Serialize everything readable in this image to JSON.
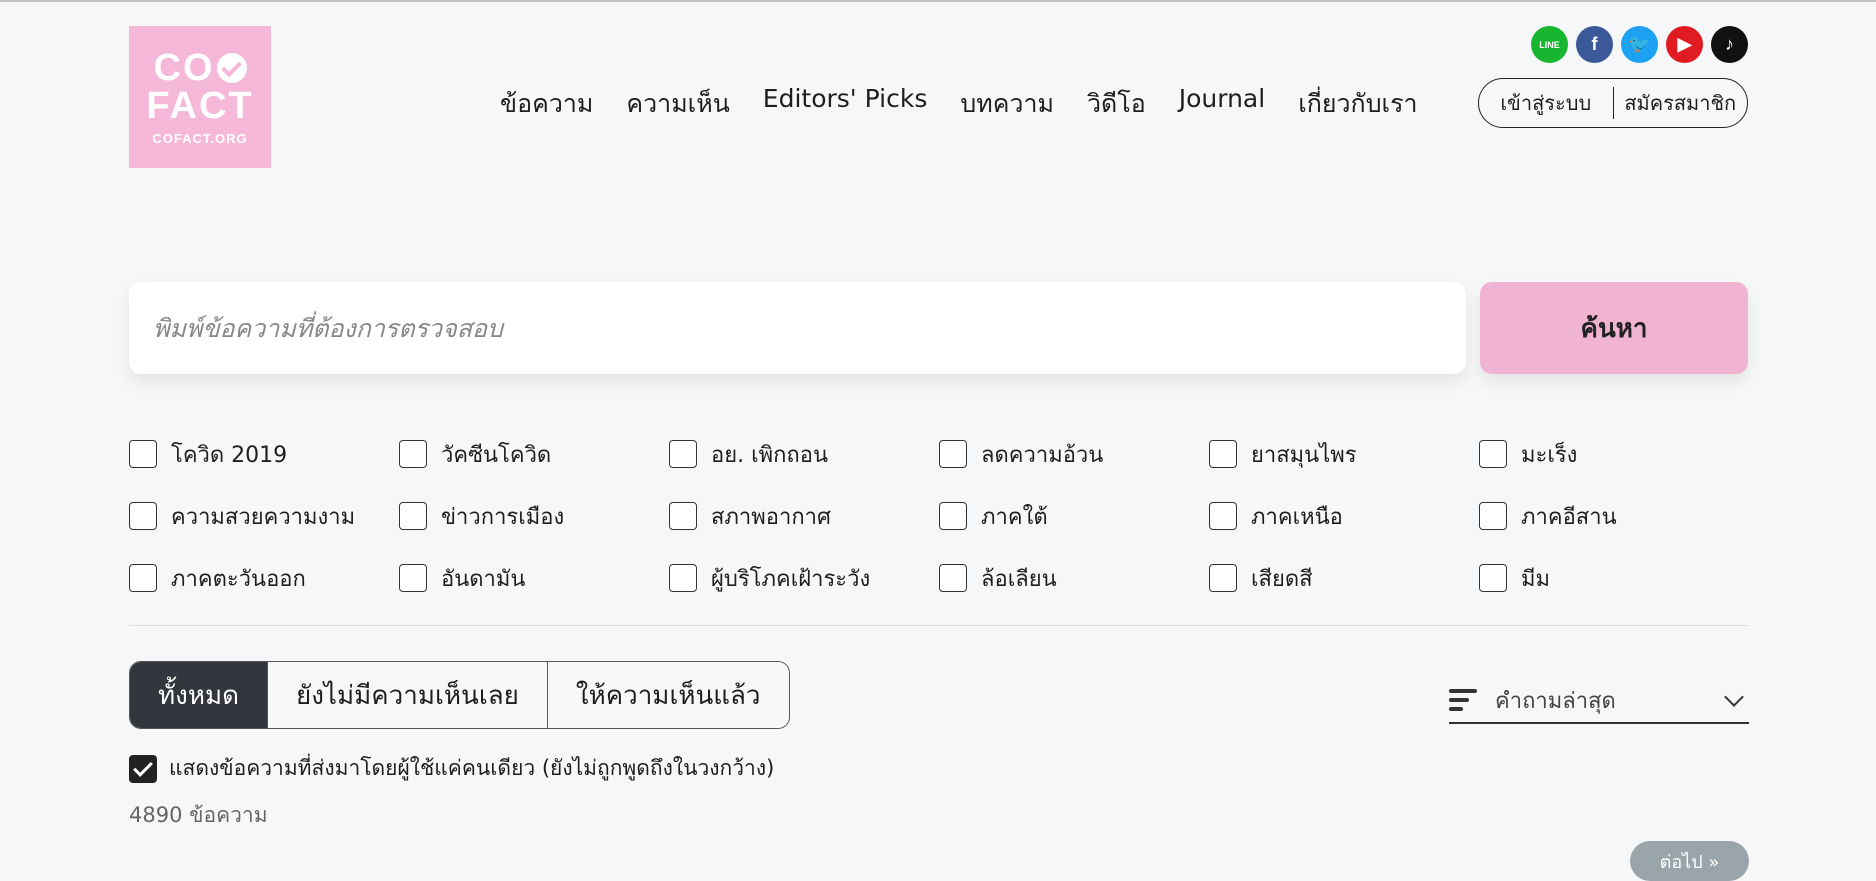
{
  "logo": {
    "line1": "CO",
    "line2": "FACT",
    "line3": "COFACT.ORG"
  },
  "social": [
    {
      "name": "line-icon",
      "glyph": "LINE"
    },
    {
      "name": "facebook-icon",
      "glyph": "f"
    },
    {
      "name": "twitter-icon",
      "glyph": "🐦"
    },
    {
      "name": "youtube-icon",
      "glyph": "▶"
    },
    {
      "name": "tiktok-icon",
      "glyph": "♪"
    }
  ],
  "nav": {
    "items": [
      "ข้อความ",
      "ความเห็น",
      "Editors' Picks",
      "บทความ",
      "วิดีโอ",
      "Journal",
      "เกี่ยวกับเรา"
    ]
  },
  "auth": {
    "login": "เข้าสู่ระบบ",
    "register": "สมัครสมาชิก"
  },
  "search": {
    "placeholder": "พิมพ์ข้อความที่ต้องการตรวจสอบ",
    "button": "ค้นหา"
  },
  "tags": [
    "โควิด 2019",
    "วัคซีนโควิด",
    "อย. เพิกถอน",
    "ลดความอ้วน",
    "ยาสมุนไพร",
    "มะเร็ง",
    "ความสวยความงาม",
    "ข่าวการเมือง",
    "สภาพอากาศ",
    "ภาคใต้",
    "ภาคเหนือ",
    "ภาคอีสาน",
    "ภาคตะวันออก",
    "อันดามัน",
    "ผู้บริโภคเฝ้าระวัง",
    "ล้อเลียน",
    " เสียดสี",
    "มีม"
  ],
  "filters": {
    "all": "ทั้งหมด",
    "no_comment": "ยังไม่มีความเห็นเลย",
    "commented": "ให้ความเห็นแล้ว"
  },
  "sort": {
    "selected": "คำถามล่าสุด"
  },
  "single_user_option": {
    "label": "แสดงข้อความที่ส่งมาโดยผู้ใช้แค่คนเดียว (ยังไม่ถูกพูดถึงในวงกว้าง)",
    "checked": true
  },
  "count": "4890 ข้อความ",
  "next": "ต่อไป »"
}
